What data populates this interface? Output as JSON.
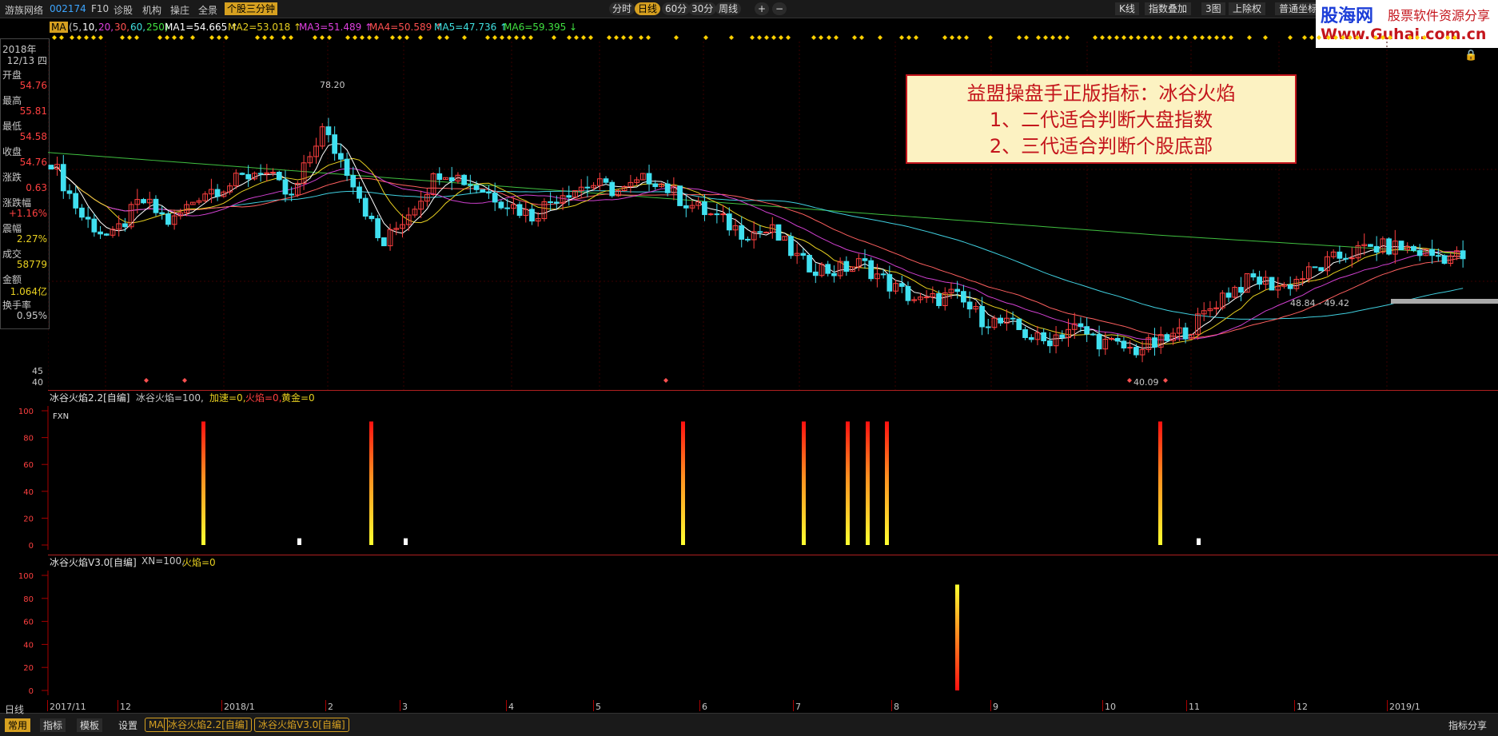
{
  "topbar": {
    "app_name": "游族网络",
    "stock_code": "002174",
    "menu": [
      "F10",
      "诊股",
      "机构",
      "操庄",
      "全景"
    ],
    "highlight_tab": "个股三分钟",
    "periods": [
      "分时",
      "日线",
      "60分",
      "30分",
      "周线"
    ],
    "active_period": "日线",
    "zoom_in": "+",
    "zoom_out": "−",
    "right_menu": [
      "K线",
      "指数叠加",
      "3图",
      "上除权",
      "普通坐标"
    ]
  },
  "logo": {
    "brand": "股海网",
    "tagline": "股票软件资源分享",
    "url": "Www.Guhai.com.cn"
  },
  "info_panel": {
    "year": "2018年",
    "date": "12/13 四",
    "rows": [
      {
        "label": "开盘",
        "value": "54.76",
        "color": "#ff4040"
      },
      {
        "label": "最高",
        "value": "55.81",
        "color": "#ff4040"
      },
      {
        "label": "最低",
        "value": "54.58",
        "color": "#ff4040"
      },
      {
        "label": "收盘",
        "value": "54.76",
        "color": "#ff4040"
      },
      {
        "label": "涨跌",
        "value": "0.63",
        "color": "#ff4040"
      },
      {
        "label": "涨跌幅",
        "value": "+1.16%",
        "color": "#ff4040"
      },
      {
        "label": "震幅",
        "value": "2.27%",
        "color": "#e8d020"
      },
      {
        "label": "成交",
        "value": "58779",
        "color": "#e8d020"
      },
      {
        "label": "金额",
        "value": "1.064亿",
        "color": "#e8d020"
      },
      {
        "label": "换手率",
        "value": "0.95%",
        "color": "#c8c8c8"
      }
    ]
  },
  "ma_legend": {
    "button": "MA",
    "params_prefix": "(5,",
    "params": [
      {
        "text": "10,",
        "color": "#ffffff"
      },
      {
        "text": "20,",
        "color": "#e040e0"
      },
      {
        "text": "30,",
        "color": "#ff5050"
      },
      {
        "text": "60,",
        "color": "#40e0e0"
      },
      {
        "text": "250)",
        "color": "#40e040"
      }
    ],
    "items": [
      {
        "text": "MA1=54.665",
        "arrow": "↑",
        "color": "#ffffff"
      },
      {
        "text": "MA2=53.018",
        "arrow": "↑",
        "color": "#e8d020"
      },
      {
        "text": "MA3=51.489",
        "arrow": "↑",
        "color": "#e040e0"
      },
      {
        "text": "MA4=50.589",
        "arrow": "↑",
        "color": "#ff5050"
      },
      {
        "text": "MA5=47.736",
        "arrow": "↑",
        "color": "#40e0e0"
      },
      {
        "text": "MA6=59.395",
        "arrow": "↓",
        "color": "#40e040"
      }
    ]
  },
  "main_chart": {
    "y_ticks": [
      "45",
      "40"
    ],
    "high_label": "78.20",
    "low_label": "40.09",
    "range_label": "48.84 - 49.42"
  },
  "overlay": {
    "line1": "益盟操盘手正版指标：冰谷火焰",
    "line2": "1、二代适合判断大盘指数",
    "line3": "2、三代适合判断个股底部"
  },
  "panel1": {
    "title": "冰谷火焰2.2[自编]",
    "params": [
      {
        "text": "冰谷火焰=100,",
        "color": "#c8c8c8"
      },
      {
        "text": "加速=0,",
        "color": "#e8d020"
      },
      {
        "text": "火焰=0,",
        "color": "#ff4040"
      },
      {
        "text": "黄金=0",
        "color": "#e8d020"
      }
    ],
    "fxn_label": "FXN",
    "y_ticks": [
      "100",
      "80",
      "60",
      "40",
      "20",
      "0"
    ]
  },
  "panel2": {
    "title": "冰谷火焰V3.0[自编]",
    "params": [
      {
        "text": "XN=100,",
        "color": "#c8c8c8"
      },
      {
        "text": "火焰=0",
        "color": "#e8d020"
      }
    ],
    "y_ticks": [
      "100",
      "80",
      "60",
      "40",
      "20",
      "0"
    ]
  },
  "x_axis": [
    "2017/11",
    "12",
    "2018/1",
    "2",
    "3",
    "4",
    "5",
    "6",
    "7",
    "8",
    "9",
    "10",
    "11",
    "12",
    "2019/1"
  ],
  "bottombar": {
    "period_label": "日线",
    "tabs": [
      "常用",
      "指标",
      "模板",
      "设置"
    ],
    "chips": [
      "MA",
      "冰谷火焰2.2[自编]",
      "冰谷火焰V3.0[自编]"
    ],
    "right_label": "指标分享"
  },
  "chart_data": {
    "type": "candlestick+line",
    "ma_series_current": [
      {
        "name": "MA1",
        "value": 54.665
      },
      {
        "name": "MA2",
        "value": 53.018
      },
      {
        "name": "MA3",
        "value": 51.489
      },
      {
        "name": "MA4",
        "value": 50.589
      },
      {
        "name": "MA5",
        "value": 47.736
      },
      {
        "name": "MA6",
        "value": 59.395
      }
    ],
    "price_extremes": {
      "high": 78.2,
      "low": 40.09
    },
    "close_path": [
      67,
      60,
      57,
      62,
      59,
      63,
      64,
      66,
      62,
      71,
      65,
      56,
      61,
      66,
      64,
      62,
      60,
      63,
      64,
      63,
      65,
      62,
      60,
      58,
      58,
      54,
      53,
      54,
      51,
      49,
      50,
      47,
      46,
      44,
      46,
      44,
      43,
      44,
      46,
      50,
      52,
      51,
      53,
      55,
      56,
      56,
      55,
      54.8
    ],
    "indicator1": {
      "name": "冰谷火焰2.2",
      "signals": [
        {
          "month": "12",
          "value": 92
        },
        {
          "month": "2",
          "value": 92
        },
        {
          "month": "5",
          "value": 92
        },
        {
          "month": "7",
          "value": 92
        },
        {
          "month": "7",
          "value": 92
        },
        {
          "month": "7",
          "value": 92
        },
        {
          "month": "7",
          "value": 92
        },
        {
          "month": "10",
          "value": 92
        }
      ],
      "ylim": [
        0,
        100
      ]
    },
    "indicator2": {
      "name": "冰谷火焰V3.0",
      "signals": [
        {
          "month": "8",
          "value": 92
        }
      ],
      "ylim": [
        0,
        100
      ]
    }
  }
}
